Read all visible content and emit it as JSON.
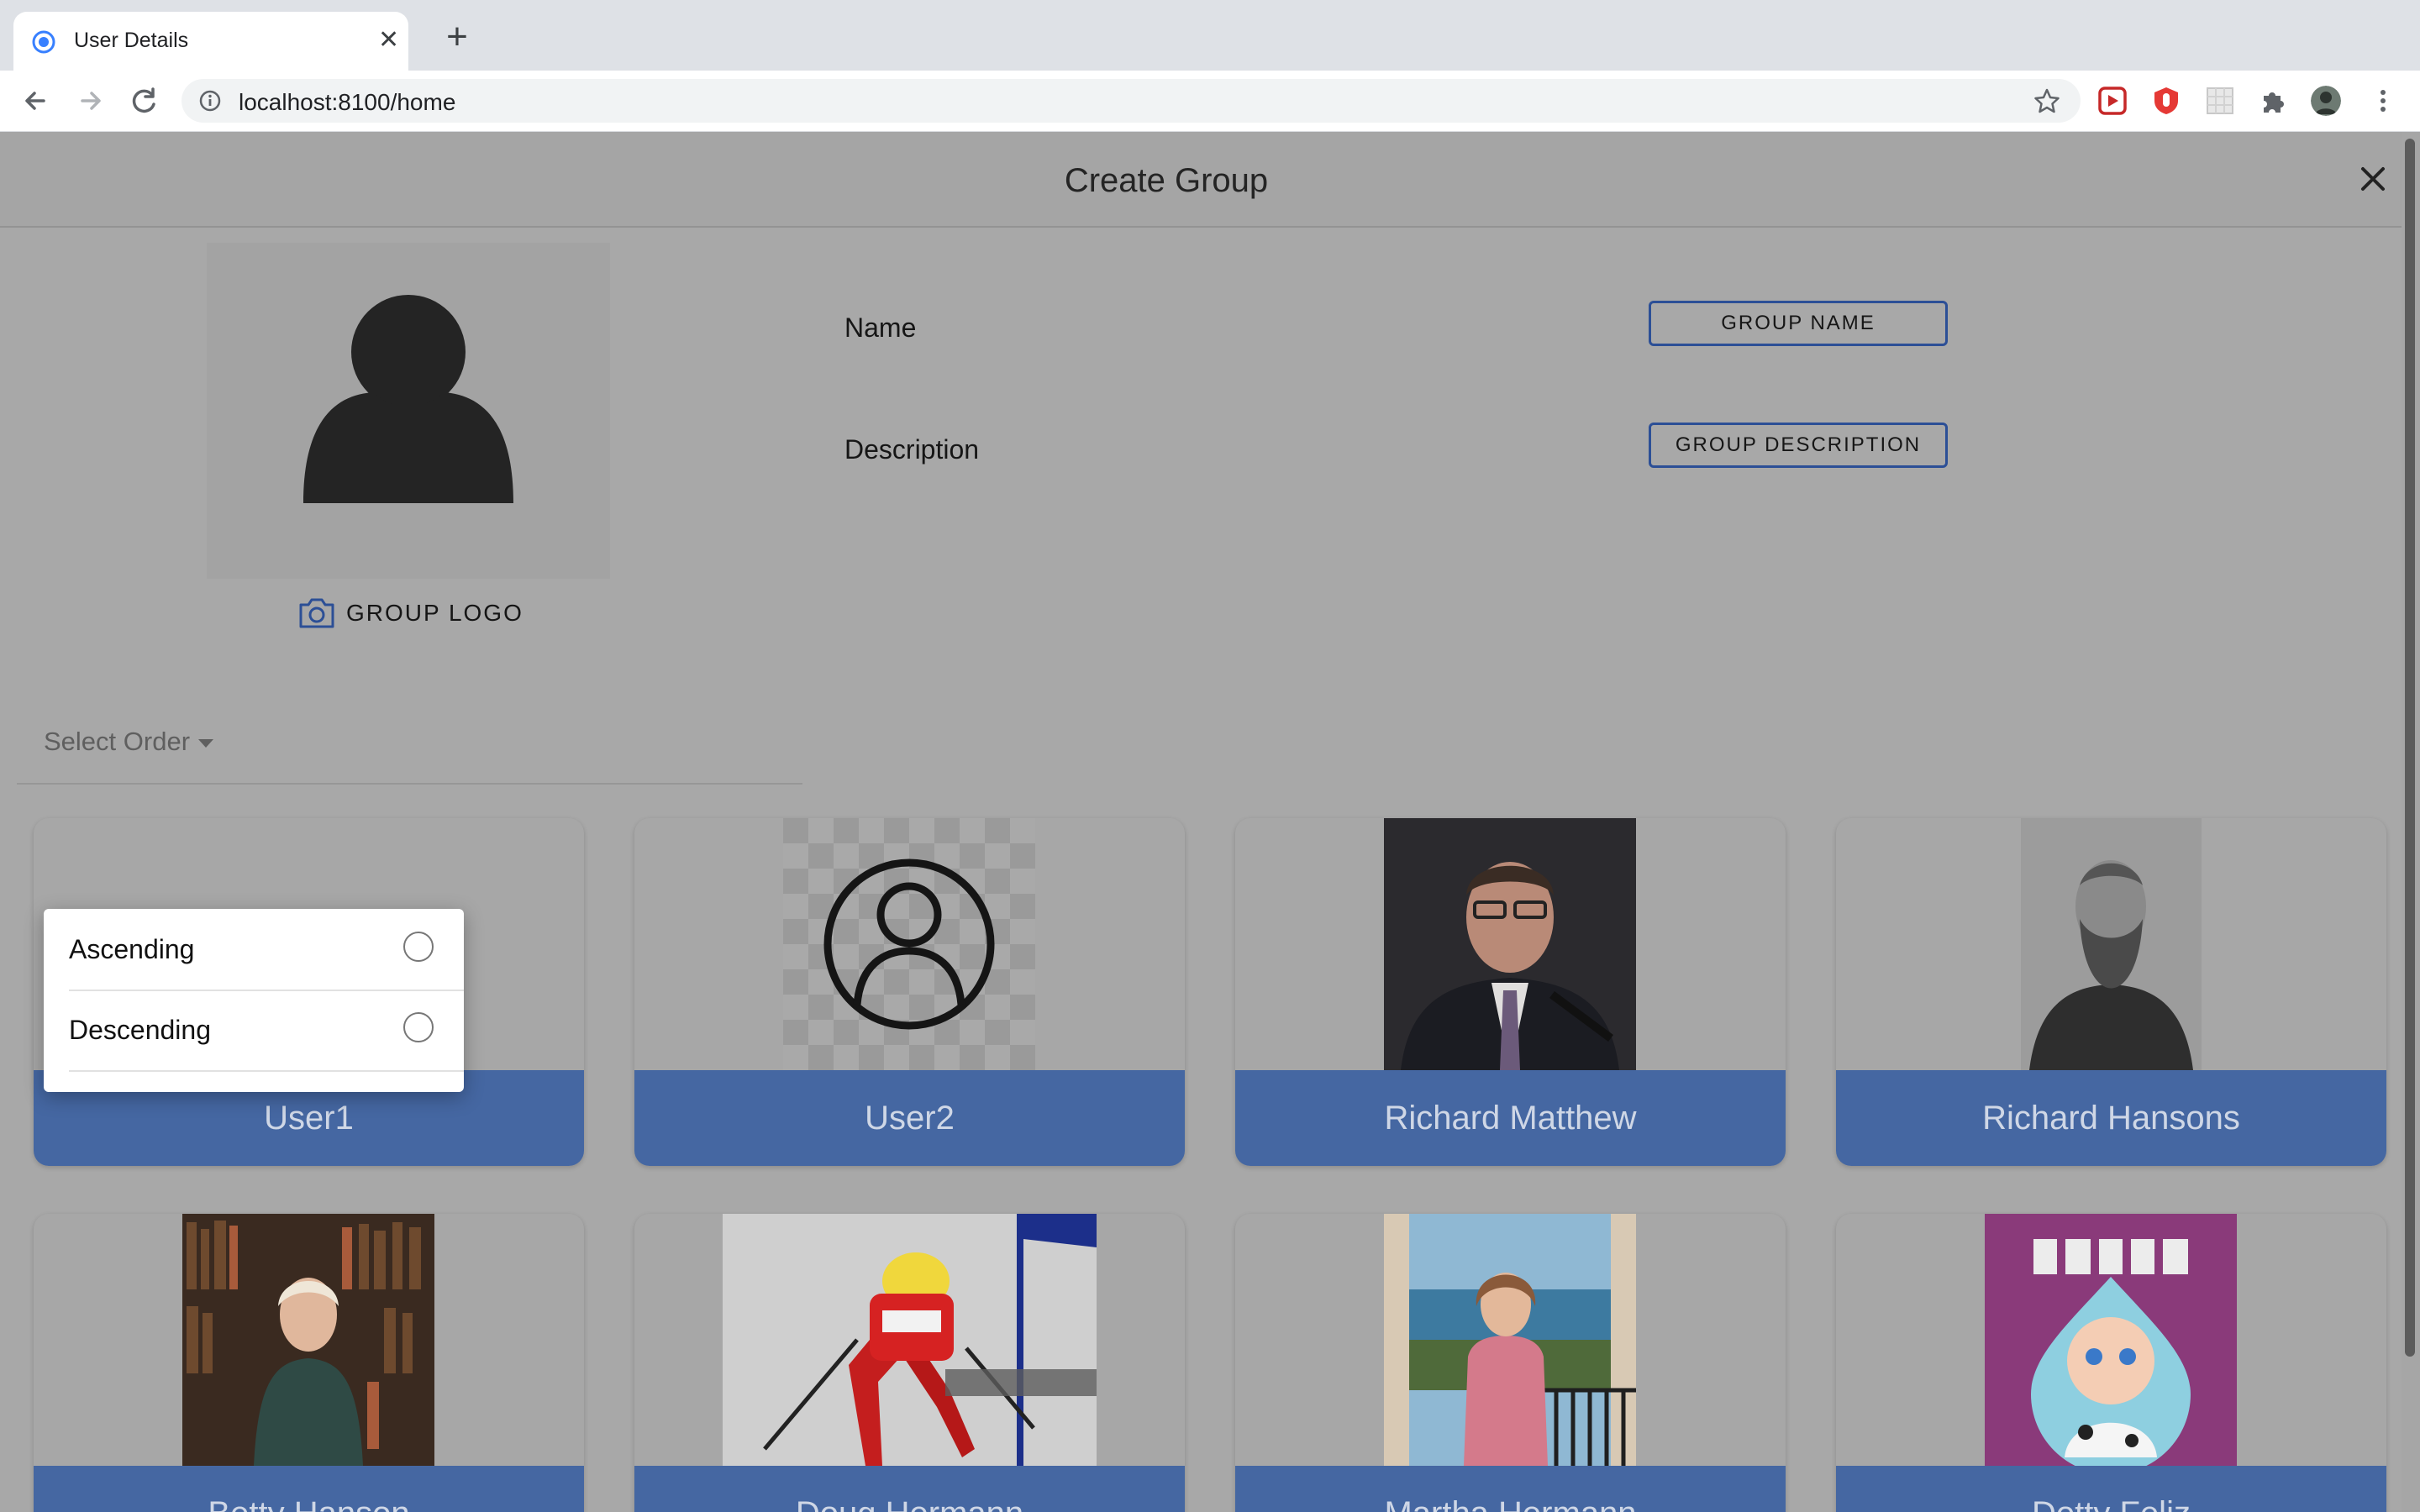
{
  "browser": {
    "tab_title": "User Details",
    "new_tab_label": "+",
    "tab_close_label": "✕",
    "url": "localhost:8100/home"
  },
  "modal": {
    "title": "Create Group"
  },
  "form": {
    "logo_button": "GROUP LOGO",
    "name_label": "Name",
    "name_button": "GROUP NAME",
    "description_label": "Description",
    "description_button": "GROUP DESCRIPTION"
  },
  "order_select": {
    "placeholder": "Select Order",
    "options": [
      {
        "label": "Ascending",
        "selected": false
      },
      {
        "label": "Descending",
        "selected": false
      }
    ]
  },
  "users": [
    {
      "name": "User1",
      "image": "default-avatar"
    },
    {
      "name": "User2",
      "image": "account-circle-icon"
    },
    {
      "name": "Richard Matthew",
      "image": "photo-man-glasses-suit"
    },
    {
      "name": "Richard Hansons",
      "image": "photo-bearded-man-engraving"
    },
    {
      "name": "Betty Hanson",
      "image": "photo-woman-bookshelves"
    },
    {
      "name": "Doug Hermann",
      "image": "photo-skier"
    },
    {
      "name": "Martha Hermann",
      "image": "photo-woman-balcony"
    },
    {
      "name": "Dotty Feliz",
      "image": "dotty-doll-illustration"
    }
  ],
  "colors": {
    "accent": "#4567a2",
    "outline": "#2c4f96",
    "backdrop": "#a8a8a8"
  }
}
